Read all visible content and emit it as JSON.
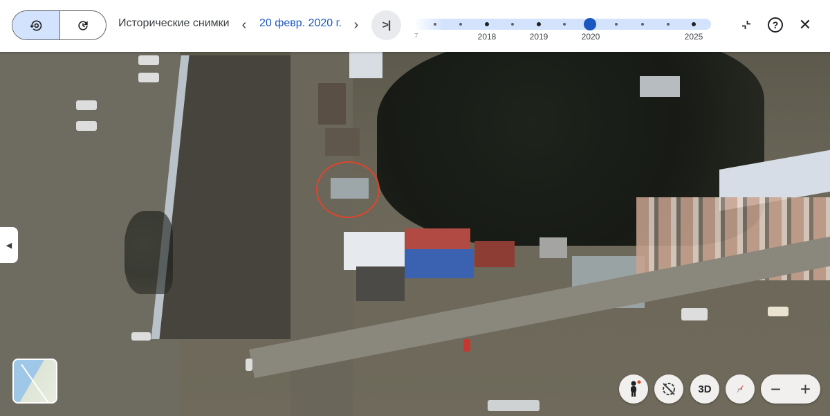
{
  "toolbar": {
    "history_icon": "history-icon",
    "refresh_icon": "refresh-icon",
    "title": "Исторические снимки",
    "prev_label": "‹",
    "date": "20 февр. 2020 г.",
    "next_label": "›",
    "jump_label": ">|"
  },
  "timeline": {
    "partial_label": "7",
    "years": [
      "2018",
      "2019",
      "2020",
      "2025"
    ],
    "selected_year": "2020"
  },
  "actions": {
    "collapse_icon": "collapse-icon",
    "help_label": "?",
    "close_label": "✕"
  },
  "map_controls": {
    "pegman_icon": "pegman-icon",
    "tilt_icon": "compass-off-icon",
    "threed_label": "3D",
    "compass_icon": "compass-icon",
    "zoom_out_label": "−",
    "zoom_in_label": "+"
  },
  "colors": {
    "accent": "#1a57c0",
    "selected_bg": "#d3e3fd",
    "marker_circle": "#e0452c"
  }
}
